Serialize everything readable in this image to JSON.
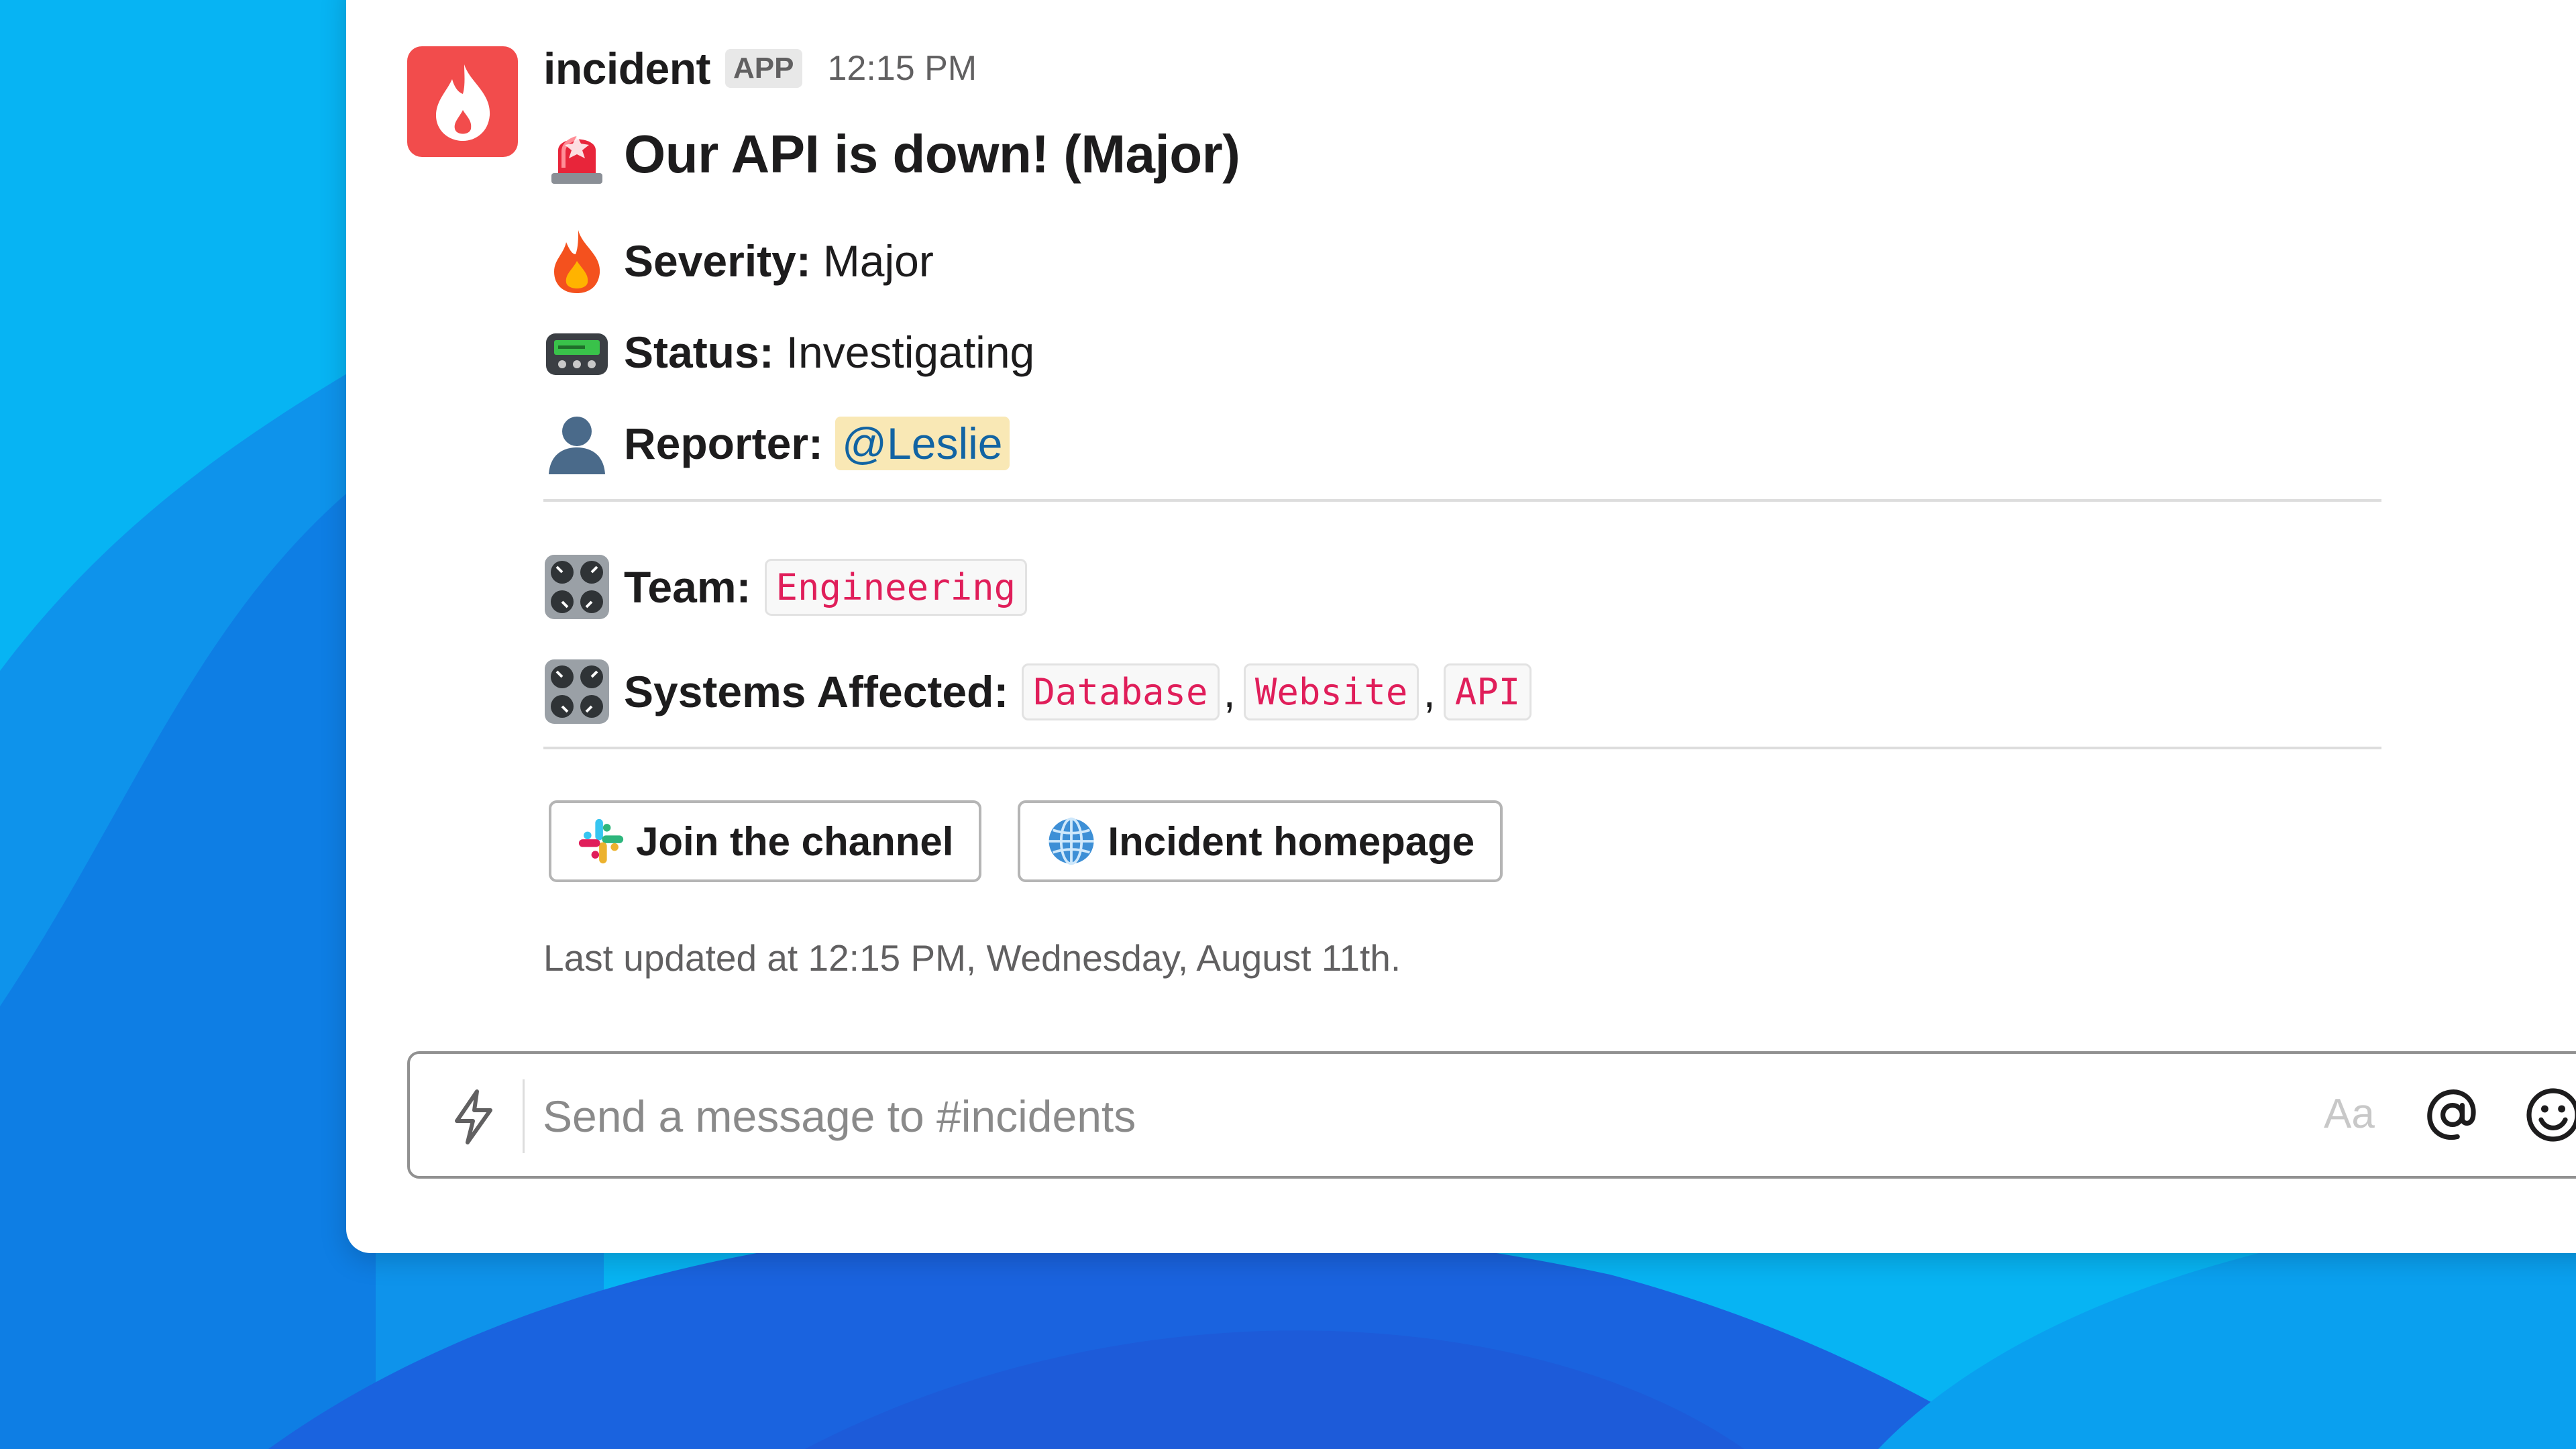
{
  "message": {
    "sender": "incident",
    "app_badge": "APP",
    "timestamp": "12:15 PM",
    "title": "Our API is down! (Major)",
    "fields": {
      "severity_label": "Severity:",
      "severity_value": "Major",
      "status_label": "Status:",
      "status_value": "Investigating",
      "reporter_label": "Reporter:",
      "reporter_value": "@Leslie",
      "team_label": "Team:",
      "team_value": "Engineering",
      "systems_label": "Systems Affected:",
      "systems": [
        "Database",
        "Website",
        "API"
      ],
      "separator": ","
    },
    "buttons": {
      "join": "Join the channel",
      "homepage": "Incident homepage"
    },
    "last_updated": "Last updated at 12:15 PM, Wednesday, August 11th."
  },
  "composer": {
    "placeholder": "Send a message to #incidents",
    "format_label": "Aa"
  },
  "icons": {
    "avatar": "flame-logo-icon",
    "title": "rotating-light-icon",
    "severity": "fire-icon",
    "status": "pager-icon",
    "reporter": "person-silhouette-icon",
    "team": "control-knobs-icon",
    "systems": "control-knobs-icon",
    "join": "slack-logo-icon",
    "homepage": "globe-icon",
    "shortcuts": "lightning-icon",
    "mention": "at-icon",
    "emoji": "emoji-icon"
  },
  "colors": {
    "avatar_bg": "#f24c4c",
    "mention_bg": "#f9e8b5",
    "mention_text": "#1264a3",
    "code_text": "#e01e5a",
    "wallpaper": "#09a8f0"
  }
}
